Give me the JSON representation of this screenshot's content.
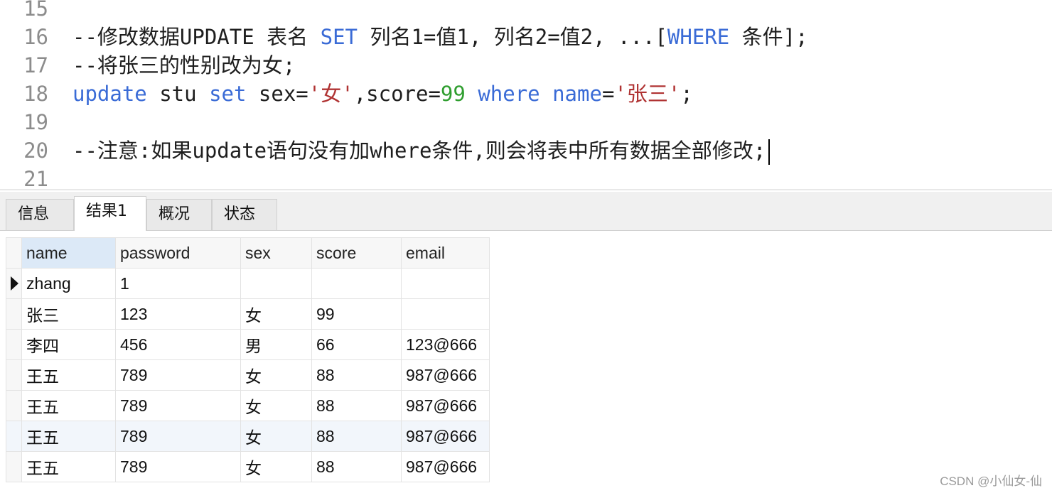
{
  "editor": {
    "lines": [
      {
        "number": "15"
      },
      {
        "number": "16",
        "parts": [
          {
            "t": "--修改数据UPDATE 表名 ",
            "c": ""
          },
          {
            "t": "SET",
            "c": "kw"
          },
          {
            "t": " 列名1=值1, 列名2=值2, ...[",
            "c": ""
          },
          {
            "t": "WHERE",
            "c": "kw"
          },
          {
            "t": " 条件];",
            "c": ""
          }
        ]
      },
      {
        "number": "17",
        "parts": [
          {
            "t": "--将张三的性别改为女;",
            "c": ""
          }
        ]
      },
      {
        "number": "18",
        "parts": [
          {
            "t": "update",
            "c": "kw"
          },
          {
            "t": " stu ",
            "c": ""
          },
          {
            "t": "set",
            "c": "kw"
          },
          {
            "t": " sex=",
            "c": ""
          },
          {
            "t": "'女'",
            "c": "str"
          },
          {
            "t": ",score=",
            "c": ""
          },
          {
            "t": "99",
            "c": "num"
          },
          {
            "t": " ",
            "c": ""
          },
          {
            "t": "where",
            "c": "kw"
          },
          {
            "t": " ",
            "c": ""
          },
          {
            "t": "name",
            "c": "kw"
          },
          {
            "t": "=",
            "c": ""
          },
          {
            "t": "'张三'",
            "c": "str"
          },
          {
            "t": ";",
            "c": ""
          }
        ]
      },
      {
        "number": "19",
        "parts": []
      },
      {
        "number": "20",
        "parts": [
          {
            "t": "--注意:如果update语句没有加where条件,则会将表中所有数据全部修改;",
            "c": ""
          }
        ],
        "caret": true
      },
      {
        "number": "21",
        "parts": []
      }
    ]
  },
  "tabs": [
    {
      "label": "信息",
      "active": false
    },
    {
      "label": "结果1",
      "active": true
    },
    {
      "label": "概况",
      "active": false
    },
    {
      "label": "状态",
      "active": false
    }
  ],
  "results": {
    "columns": [
      "name",
      "password",
      "sex",
      "score",
      "email"
    ],
    "rows": [
      [
        "zhang",
        "1",
        "",
        "",
        ""
      ],
      [
        "张三",
        "123",
        "女",
        "99",
        ""
      ],
      [
        "李四",
        "456",
        "男",
        "66",
        "123@666"
      ],
      [
        "王五",
        "789",
        "女",
        "88",
        "987@666"
      ],
      [
        "王五",
        "789",
        "女",
        "88",
        "987@666"
      ],
      [
        "王五",
        "789",
        "女",
        "88",
        "987@666"
      ],
      [
        "王五",
        "789",
        "女",
        "88",
        "987@666"
      ]
    ],
    "current_row": 0,
    "highlight_row": 5
  },
  "watermark": "CSDN @小仙女-仙"
}
